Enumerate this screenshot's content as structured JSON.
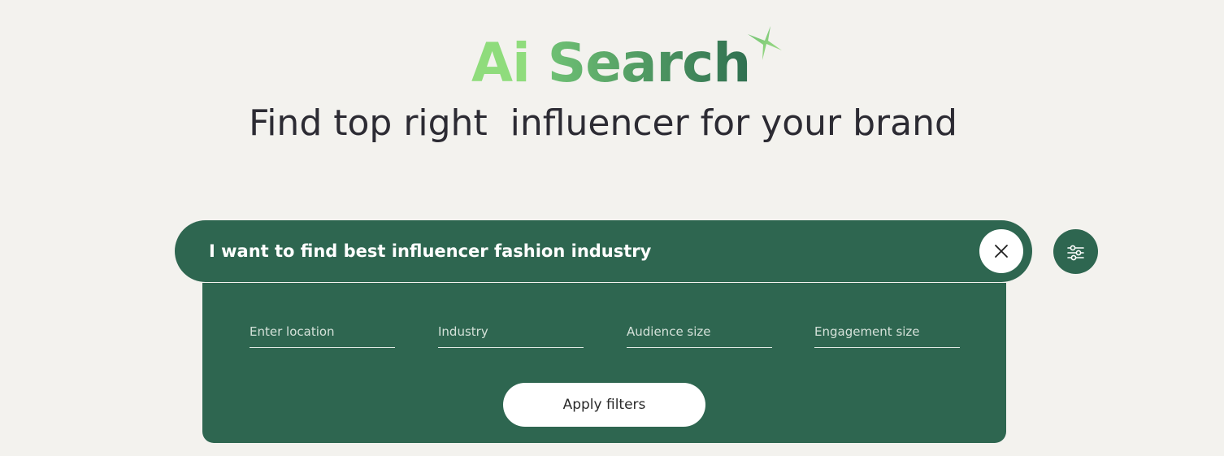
{
  "header": {
    "title_part1": "Ai",
    "title_part2": "Search",
    "sparkle_icon": "sparkle-icon",
    "tagline": "Find top right  influencer for your brand"
  },
  "search": {
    "value": "I want to find best influencer fashion industry",
    "clear_icon": "close-icon",
    "filter_icon": "sliders-icon"
  },
  "filters": {
    "location_placeholder": "Enter location",
    "industry_placeholder": "Industry",
    "audience_placeholder": "Audience size",
    "engagement_placeholder": "Engagement size",
    "apply_label": "Apply filters"
  },
  "colors": {
    "primary_green": "#2e6650",
    "light_green": "#8fdc7c",
    "background": "#f3f2ee",
    "text_dark": "#2c2b33"
  }
}
